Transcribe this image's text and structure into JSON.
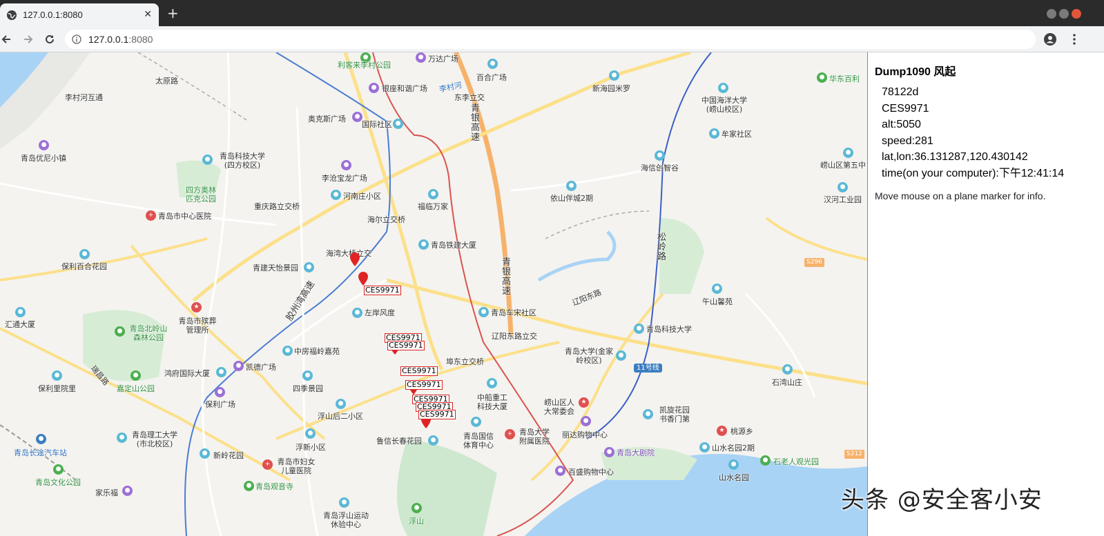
{
  "browser": {
    "tab_title": "127.0.0.1:8080",
    "url_host": "127.0.0.1",
    "url_port": ":8080"
  },
  "map": {
    "roads": [
      "太原路",
      "重庆路立交桥",
      "海尔立交桥",
      "海湾大桥立交",
      "东李立交",
      "青银高速",
      "青银高速",
      "辽阳东路立交",
      "埠东立交桥",
      "辽阳东路",
      "瑞昌路",
      "胶州湾高速",
      "松岭路",
      "11号线"
    ],
    "places": [
      {
        "text": "利客来李村公园",
        "cls": "green"
      },
      {
        "text": "万达广场",
        "cls": ""
      },
      {
        "text": "李村河",
        "cls": "blue"
      },
      {
        "text": "百合广场",
        "cls": ""
      },
      {
        "text": "新海园米罗",
        "cls": ""
      },
      {
        "text": "李村河互通",
        "cls": ""
      },
      {
        "text": "银座和谐广场",
        "cls": ""
      },
      {
        "text": "奥克斯广场",
        "cls": ""
      },
      {
        "text": "国际社区",
        "cls": ""
      },
      {
        "text": "青岛优尼小镇",
        "cls": ""
      },
      {
        "text": "青岛科技大学(四方校区)",
        "cls": ""
      },
      {
        "text": "李沧宝龙广场",
        "cls": ""
      },
      {
        "text": "河南庄小区",
        "cls": ""
      },
      {
        "text": "福临万家",
        "cls": ""
      },
      {
        "text": "四方奥林匹克公园",
        "cls": "green"
      },
      {
        "text": "青岛市中心医院",
        "cls": ""
      },
      {
        "text": "青岛铁建大厦",
        "cls": ""
      },
      {
        "text": "依山伴城2期",
        "cls": ""
      },
      {
        "text": "保利百合花园",
        "cls": ""
      },
      {
        "text": "青建天怡景园",
        "cls": ""
      },
      {
        "text": "青岛市殡葬管理所",
        "cls": ""
      },
      {
        "text": "左岸风度",
        "cls": ""
      },
      {
        "text": "青岛车宋社区",
        "cls": ""
      },
      {
        "text": "汇通大厦",
        "cls": ""
      },
      {
        "text": "青岛北岭山森林公园",
        "cls": "green"
      },
      {
        "text": "中房福岭嘉苑",
        "cls": ""
      },
      {
        "text": "青岛大学(金家岭校区)",
        "cls": ""
      },
      {
        "text": "青岛科技大学",
        "cls": ""
      },
      {
        "text": "鸿府国际大厦",
        "cls": ""
      },
      {
        "text": "凯德广场",
        "cls": ""
      },
      {
        "text": "四季景园",
        "cls": ""
      },
      {
        "text": "保利里院里",
        "cls": ""
      },
      {
        "text": "嘉定山公园",
        "cls": "green"
      },
      {
        "text": "保利广场",
        "cls": ""
      },
      {
        "text": "浮山后二小区",
        "cls": ""
      },
      {
        "text": "中船重工科技大厦",
        "cls": ""
      },
      {
        "text": "崂山区人大常委会",
        "cls": ""
      },
      {
        "text": "青岛理工大学(市北校区)",
        "cls": ""
      },
      {
        "text": "浮新小区",
        "cls": ""
      },
      {
        "text": "鲁信长春花园",
        "cls": ""
      },
      {
        "text": "青岛国信体育中心",
        "cls": ""
      },
      {
        "text": "青岛大学附属医院",
        "cls": ""
      },
      {
        "text": "丽达购物中心",
        "cls": ""
      },
      {
        "text": "凯旋花园书香门第",
        "cls": ""
      },
      {
        "text": "青岛长途汽车站",
        "cls": "blue"
      },
      {
        "text": "新岭花园",
        "cls": ""
      },
      {
        "text": "青岛市妇女儿童医院",
        "cls": ""
      },
      {
        "text": "青岛大剧院",
        "cls": "purple"
      },
      {
        "text": "百盛购物中心",
        "cls": ""
      },
      {
        "text": "山水名园2期",
        "cls": ""
      },
      {
        "text": "石老人观光园",
        "cls": "green"
      },
      {
        "text": "桃源乡",
        "cls": ""
      },
      {
        "text": "青岛文化公园",
        "cls": "green"
      },
      {
        "text": "青岛观音寺",
        "cls": "green"
      },
      {
        "text": "家乐福",
        "cls": ""
      },
      {
        "text": "青岛浮山运动休验中心",
        "cls": ""
      },
      {
        "text": "浮山",
        "cls": "green"
      },
      {
        "text": "山水名园",
        "cls": ""
      },
      {
        "text": "石湾山庄",
        "cls": ""
      },
      {
        "text": "午山馨苑",
        "cls": ""
      },
      {
        "text": "中国海洋大学(崂山校区)",
        "cls": ""
      },
      {
        "text": "华东百利",
        "cls": "green"
      },
      {
        "text": "牟家社区",
        "cls": ""
      },
      {
        "text": "海信创智谷",
        "cls": ""
      },
      {
        "text": "崂山区第五中",
        "cls": ""
      },
      {
        "text": "汉河工业园",
        "cls": ""
      }
    ],
    "plane_labels": [
      "CES9971",
      "CES9971",
      "CES9971",
      "CES9971",
      "CES9971",
      "CES9971",
      "CES9971",
      "CES9971"
    ],
    "route_shields": [
      "S296",
      "S212"
    ]
  },
  "panel": {
    "title": "Dump1090 风起",
    "icao": "78122d",
    "flight": "CES9971",
    "alt": "alt:5050",
    "speed": "speed:281",
    "latlon": "lat,lon:36.131287,120.430142",
    "time": "time(on your computer):下午12:41:14",
    "hint": "Move mouse on a plane marker for info."
  },
  "watermark": "头条 @安全客小安"
}
